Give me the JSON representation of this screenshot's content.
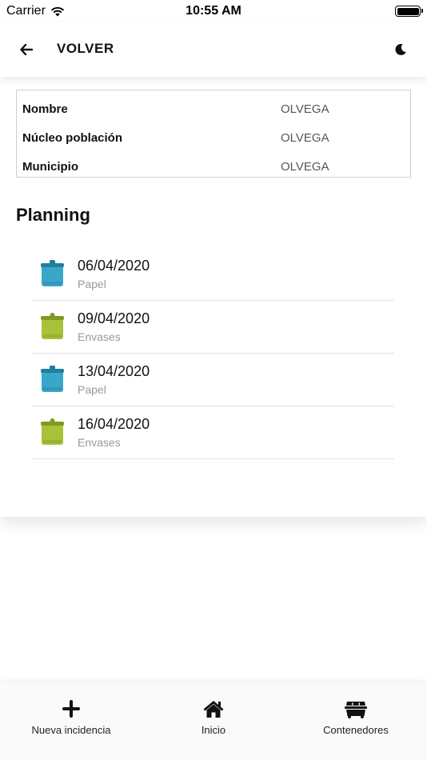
{
  "status_bar": {
    "carrier": "Carrier",
    "time": "10:55 AM"
  },
  "header": {
    "title": "VOLVER",
    "back_icon": "arrow-left-icon",
    "theme_icon": "moon-icon"
  },
  "info": [
    {
      "label": "Nombre",
      "value": "OLVEGA"
    },
    {
      "label": "Núcleo población",
      "value": "OLVEGA"
    },
    {
      "label": "Municipio",
      "value": "OLVEGA"
    }
  ],
  "planning": {
    "title": "Planning",
    "items": [
      {
        "date": "06/04/2020",
        "type": "Papel",
        "bin_color": "#3aa6c9"
      },
      {
        "date": "09/04/2020",
        "type": "Envases",
        "bin_color": "#a8c23a"
      },
      {
        "date": "13/04/2020",
        "type": "Papel",
        "bin_color": "#3aa6c9"
      },
      {
        "date": "16/04/2020",
        "type": "Envases",
        "bin_color": "#a8c23a"
      }
    ]
  },
  "tabbar": {
    "tabs": [
      {
        "label": "Nueva incidencia",
        "icon": "plus-icon"
      },
      {
        "label": "Inicio",
        "icon": "home-icon"
      },
      {
        "label": "Contenedores",
        "icon": "dumpster-icon"
      }
    ]
  }
}
